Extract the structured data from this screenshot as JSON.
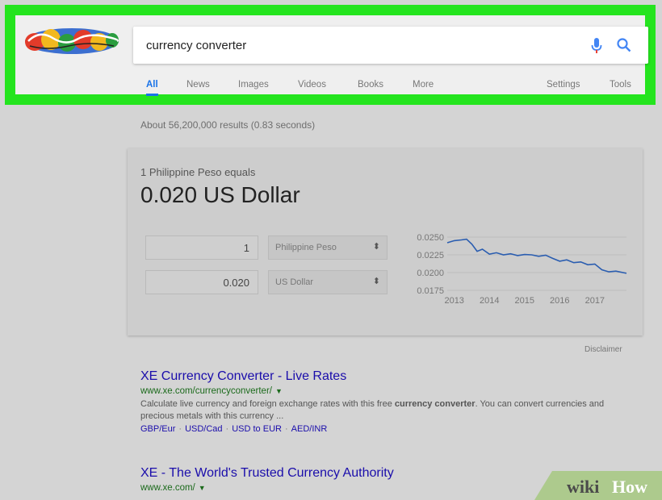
{
  "search": {
    "query": "currency converter"
  },
  "tabs": [
    {
      "label": "All"
    },
    {
      "label": "News"
    },
    {
      "label": "Images"
    },
    {
      "label": "Videos"
    },
    {
      "label": "Books"
    },
    {
      "label": "More"
    },
    {
      "label": "Settings"
    },
    {
      "label": "Tools"
    }
  ],
  "stats": "About 56,200,000 results (0.83 seconds)",
  "converter": {
    "equals_label": "1 Philippine Peso equals",
    "result": "0.020 US Dollar",
    "from_amount": "1",
    "from_currency": "Philippine Peso",
    "to_amount": "0.020",
    "to_currency": "US Dollar",
    "disclaimer": "Disclaimer"
  },
  "chart_data": {
    "type": "line",
    "x_ticks": [
      "2013",
      "2014",
      "2015",
      "2016",
      "2017"
    ],
    "y_ticks": [
      "0.0250",
      "0.0225",
      "0.0200",
      "0.0175"
    ],
    "ylim": [
      0.0175,
      0.025
    ],
    "xlim": [
      2012.8,
      2017.9
    ],
    "color": "#2a5db0",
    "series": [
      {
        "x": [
          2012.8,
          2013.0,
          2013.2,
          2013.35,
          2013.5,
          2013.65,
          2013.8,
          2014.0,
          2014.2,
          2014.4,
          2014.6,
          2014.8,
          2015.0,
          2015.2,
          2015.4,
          2015.6,
          2015.8,
          2016.0,
          2016.2,
          2016.4,
          2016.6,
          2016.8,
          2017.0,
          2017.2,
          2017.4,
          2017.6,
          2017.9
        ],
        "y": [
          0.0242,
          0.0245,
          0.0246,
          0.0247,
          0.024,
          0.023,
          0.0233,
          0.0226,
          0.0228,
          0.0225,
          0.02265,
          0.0224,
          0.02255,
          0.0225,
          0.0223,
          0.02245,
          0.022,
          0.0216,
          0.0218,
          0.0214,
          0.0215,
          0.0211,
          0.0212,
          0.0204,
          0.0201,
          0.0202,
          0.0199
        ]
      }
    ]
  },
  "results": [
    {
      "title": "XE Currency Converter - Live Rates",
      "url": "www.xe.com/currencyconverter/",
      "snippet_parts": [
        "Calculate live currency and foreign exchange rates with this free ",
        "currency converter",
        ". You can convert currencies and precious metals with this currency ..."
      ],
      "links": [
        "GBP/Eur",
        "USD/Cad",
        "USD to EUR",
        "AED/INR"
      ]
    },
    {
      "title": "XE - The World's Trusted Currency Authority",
      "url": "www.xe.com/"
    }
  ],
  "icons": {
    "mic": "mic-icon",
    "search": "search-icon",
    "url_menu": "caret-down-icon"
  },
  "colors": {
    "highlight": "#24e41e",
    "link": "#1a0dab",
    "tab_active": "#1a73e8",
    "url": "#1b6a1b"
  },
  "watermark": {
    "text_a": "wiki",
    "text_b": "How"
  }
}
